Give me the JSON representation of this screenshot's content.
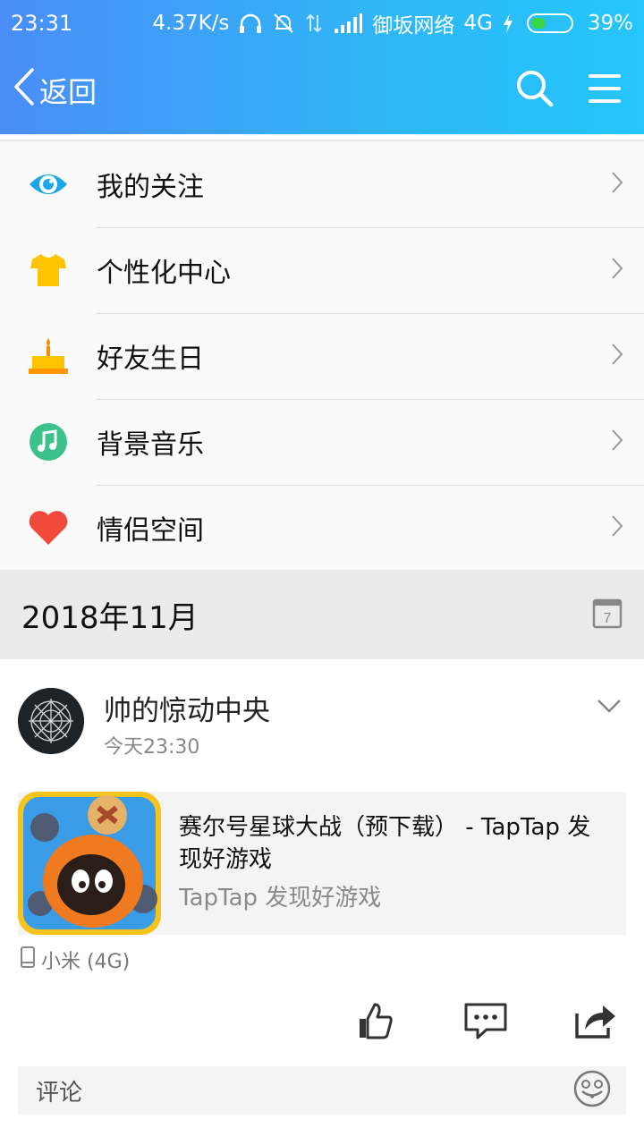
{
  "status_bar": {
    "time": "23:31",
    "speed": "4.37K/s",
    "carrier": "御坂网络",
    "network": "4G",
    "battery_percent": "39%",
    "battery_level": 0.39,
    "icons": [
      "headphones-icon",
      "bell-off-icon",
      "data-arrows-icon",
      "signal-icon",
      "charging-icon",
      "battery-icon"
    ]
  },
  "nav": {
    "back_label": "返回",
    "icons": [
      "back-chevron-icon",
      "search-icon",
      "menu-icon"
    ]
  },
  "menu": {
    "items": [
      {
        "label": "我的关注",
        "icon": "eye-icon",
        "color": "#1aa6e8"
      },
      {
        "label": "个性化中心",
        "icon": "shirt-icon",
        "color": "#ffc400"
      },
      {
        "label": "好友生日",
        "icon": "cake-icon",
        "color": "#ffb300"
      },
      {
        "label": "背景音乐",
        "icon": "music-note-icon",
        "color": "#3ac28a"
      },
      {
        "label": "情侣空间",
        "icon": "heart-icon",
        "color": "#f04a3c"
      }
    ]
  },
  "month": {
    "label": "2018年11月",
    "calendar_day": "7"
  },
  "post": {
    "author": "帅的惊动中央",
    "time": "今天23:30",
    "share": {
      "title": "赛尔号星球大战（预下载） - TapTap 发现好游戏",
      "source": "TapTap 发现好游戏"
    },
    "device": "小米 (4G)",
    "comment_placeholder": "评论"
  },
  "colors": {
    "header_start": "#4a8df7",
    "header_end": "#24c6fb"
  }
}
